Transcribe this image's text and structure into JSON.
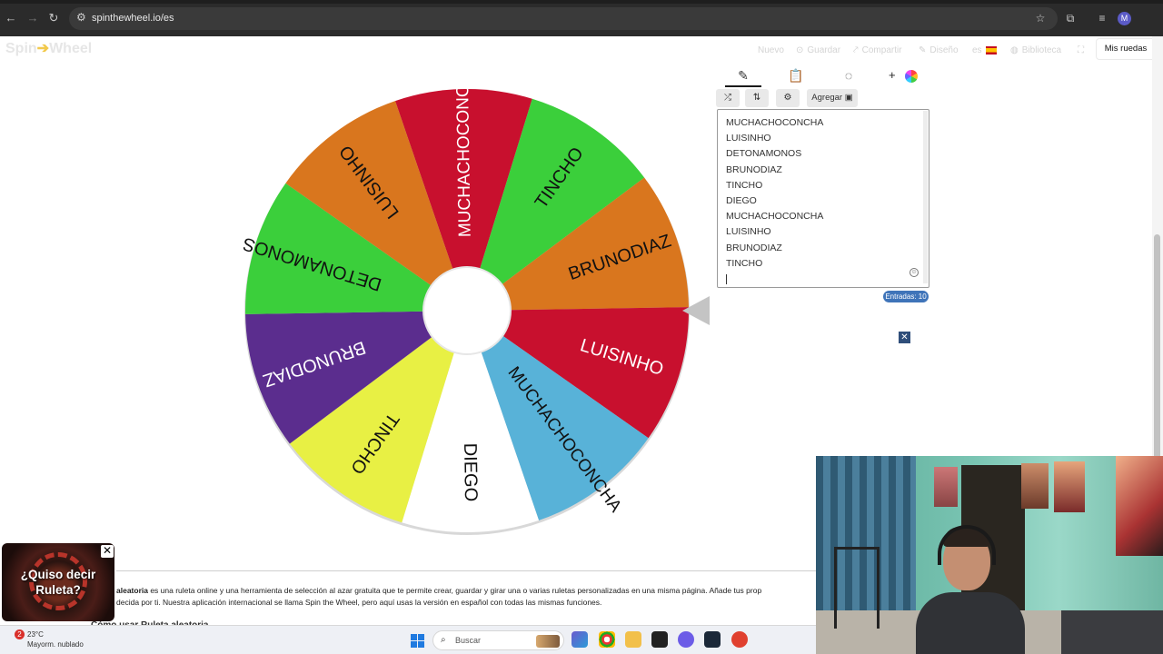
{
  "browser": {
    "url": "spinthewheel.io/es",
    "profile_initial": "M"
  },
  "site": {
    "logo_part1": "Spin",
    "logo_part2": "Wheel",
    "menu": {
      "nuevo": "Nuevo",
      "guardar": "Guardar",
      "compartir": "Compartir",
      "diseno": "Diseño",
      "language": "es",
      "biblioteca": "Biblioteca"
    },
    "mis_ruedas": "Mis ruedas"
  },
  "wheel": {
    "segments": [
      {
        "label": "MUCHACHOCONCHA",
        "color": "#c8102e"
      },
      {
        "label": "TINCHO",
        "color": "#3bcf3b"
      },
      {
        "label": "BRUNODIAZ",
        "color": "#d9761e"
      },
      {
        "label": "LUISINHO",
        "color": "#c8102e"
      },
      {
        "label": "MUCHACHOCONCHA",
        "color": "#58b2d8"
      },
      {
        "label": "DIEGO",
        "color": "#ffffff"
      },
      {
        "label": "TINCHO",
        "color": "#e8f044"
      },
      {
        "label": "BRUNODIAZ",
        "color": "#5b2d8e"
      },
      {
        "label": "DETONAMONOS",
        "color": "#3bcf3b"
      },
      {
        "label": "LUISINHO",
        "color": "#d9761e"
      }
    ]
  },
  "panel": {
    "agregar": "Agregar",
    "entries": [
      "MUCHACHOCONCHA",
      "LUISINHO",
      "DETONAMONOS",
      "BRUNODIAZ",
      "TINCHO",
      "DIEGO",
      "MUCHACHOCONCHA",
      "LUISINHO",
      "BRUNODIAZ",
      "TINCHO"
    ],
    "entries_badge": "Entradas: 10"
  },
  "description": {
    "line1_bold": "aleatoria",
    "line1": " es una ruleta online y una herramienta de selección al azar gratuita que te permite crear, guardar y girar una o varias ruletas personalizadas en una misma página. Añade tus prop",
    "line2": "decida por ti. Nuestra aplicación internacional se llama Spin the Wheel, pero aquí usas la versión en español con todas las mismas funciones.",
    "heading": "Cómo usar Ruleta aleatoria"
  },
  "ad": {
    "text": "¿Quiso decir Ruleta?"
  },
  "taskbar": {
    "weather_badge": "2",
    "weather_temp": "23°C",
    "weather_desc": "Mayorm. nublado",
    "search_label": "Buscar"
  }
}
